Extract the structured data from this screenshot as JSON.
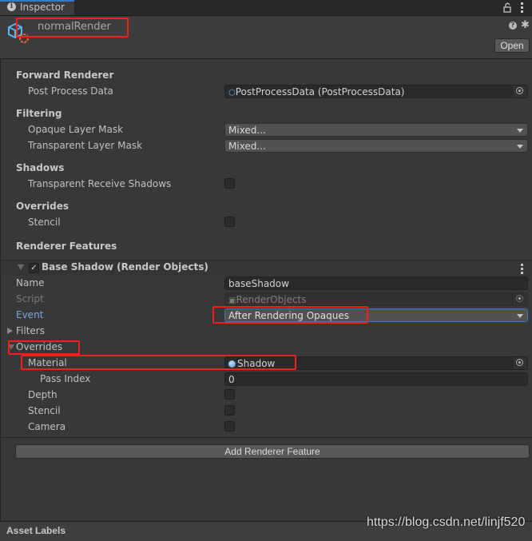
{
  "tab": {
    "label": "Inspector",
    "icon": "info-icon"
  },
  "header": {
    "asset_name": "normalRender",
    "open_label": "Open"
  },
  "forward_renderer": {
    "title": "Forward Renderer",
    "post_process_label": "Post Process Data",
    "post_process_value": "PostProcessData (PostProcessData)"
  },
  "filtering": {
    "title": "Filtering",
    "opaque_label": "Opaque Layer Mask",
    "opaque_value": "Mixed...",
    "transparent_label": "Transparent Layer Mask",
    "transparent_value": "Mixed..."
  },
  "shadows": {
    "title": "Shadows",
    "receive_label": "Transparent Receive Shadows",
    "receive_checked": false
  },
  "overrides": {
    "title": "Overrides",
    "stencil_label": "Stencil",
    "stencil_checked": false
  },
  "renderer_features": {
    "title": "Renderer Features",
    "feature": {
      "title": "Base Shadow (Render Objects)",
      "enabled": true,
      "name_label": "Name",
      "name_value": "baseShadow",
      "script_label": "Script",
      "script_value": "RenderObjects",
      "event_label": "Event",
      "event_value": "After Rendering Opaques",
      "filters_label": "Filters",
      "overrides_label": "Overrides",
      "material_label": "Material",
      "material_value": "Shadow",
      "pass_index_label": "Pass Index",
      "pass_index_value": "0",
      "depth_label": "Depth",
      "stencil_label": "Stencil",
      "camera_label": "Camera"
    },
    "add_button": "Add Renderer Feature"
  },
  "footer": {
    "asset_labels": "Asset Labels"
  },
  "watermark": "https://blog.csdn.net/linjf520",
  "colors": {
    "accent": "#3a79bb",
    "annotation": "#f21f1f",
    "event_label": "#7ba4e0"
  }
}
